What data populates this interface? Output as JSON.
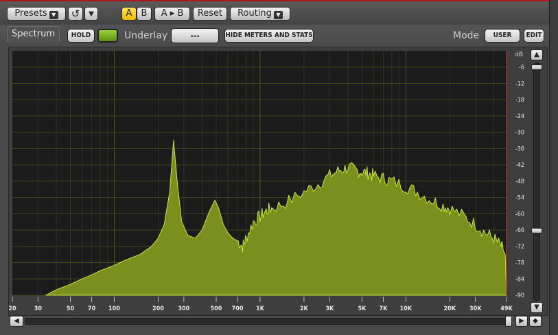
{
  "toolbar": {
    "presets_label": "Presets",
    "undo_icon": "undo-icon",
    "a_label": "A",
    "b_label": "B",
    "a_to_b_label": "A ▸ B",
    "reset_label": "Reset",
    "routing_label": "Routing"
  },
  "subbar": {
    "tab_label": "Spectrum",
    "hold_label": "HOLD",
    "underlay_label": "Underlay",
    "underlay_value": "---",
    "hide_meters_label": "HIDE METERS AND STATS",
    "mode_label": "Mode",
    "mode_value": "USER",
    "edit_label": "EDIT"
  },
  "colors": {
    "accent": "#f2c400",
    "spectrum_fill": "#7a8f1e",
    "spectrum_line": "#c9e83a",
    "plot_bg": "#1b1b1b",
    "grid": "#3f4a1e",
    "ceiling_line": "#c03030"
  },
  "chart_data": {
    "type": "area",
    "xscale": "log",
    "xlim": [
      20,
      49000
    ],
    "ylim": [
      -90,
      0
    ],
    "x_tick_labels": [
      "20",
      "30",
      "50",
      "70",
      "100",
      "200",
      "300",
      "500",
      "700",
      "1K",
      "2K",
      "3K",
      "5K",
      "7K",
      "10K",
      "20K",
      "30K",
      "49K"
    ],
    "x_tick_values": [
      20,
      30,
      50,
      70,
      100,
      200,
      300,
      500,
      700,
      1000,
      2000,
      3000,
      5000,
      7000,
      10000,
      20000,
      30000,
      49000
    ],
    "y_tick_labels": [
      "-6",
      "-12",
      "-18",
      "-24",
      "-30",
      "-36",
      "-42",
      "-48",
      "-54",
      "-60",
      "-66",
      "-72",
      "-78",
      "-84",
      "-90"
    ],
    "y_tick_values": [
      -6,
      -12,
      -18,
      -24,
      -30,
      -36,
      -42,
      -48,
      -54,
      -60,
      -66,
      -72,
      -78,
      -84,
      -90
    ],
    "top_label": "dB",
    "series": [
      {
        "x": [
          34,
          40,
          50,
          60,
          70,
          80,
          100,
          120,
          150,
          180,
          200,
          220,
          240,
          255,
          270,
          290,
          320,
          360,
          400,
          450,
          490,
          520,
          560,
          600,
          650,
          700,
          760,
          800,
          900,
          1000,
          1100,
          1200,
          1500,
          2000,
          2500,
          3000,
          3500,
          4000,
          4500,
          5000,
          5500,
          6000,
          7000,
          8000,
          10000,
          12000,
          15000,
          18000,
          20000,
          25000,
          30000,
          35000,
          40000,
          45000,
          48000,
          49000
        ],
        "y": [
          -90,
          -88,
          -86,
          -84,
          -82.5,
          -81,
          -79,
          -77,
          -75,
          -72,
          -69,
          -64,
          -52,
          -33,
          -48,
          -63,
          -68,
          -69,
          -66,
          -59,
          -55,
          -58,
          -64,
          -67,
          -69,
          -70,
          -72,
          -69,
          -63,
          -61,
          -59,
          -58,
          -56,
          -52,
          -49,
          -46,
          -44,
          -43,
          -44,
          -44.5,
          -45,
          -46,
          -47,
          -48,
          -50,
          -52,
          -55,
          -57,
          -58,
          -61,
          -64,
          -67,
          -69,
          -72,
          -75,
          -90
        ]
      }
    ]
  }
}
